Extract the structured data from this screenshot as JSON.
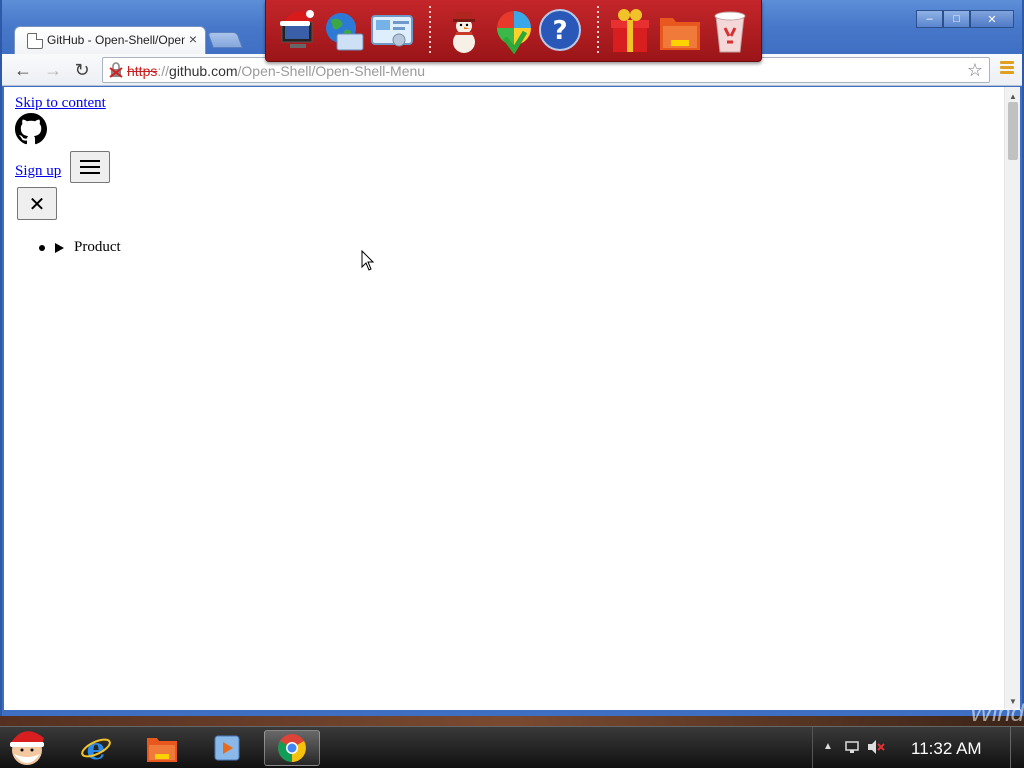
{
  "browser": {
    "tab": {
      "title": "GitHub - Open-Shell/Open-Shell-Menu",
      "close_glyph": "×"
    },
    "window_controls": {
      "minimize": "–",
      "maximize": "□",
      "close": "✕"
    },
    "toolbar": {
      "back_glyph": "←",
      "forward_glyph": "→",
      "reload_glyph": "↻",
      "url_scheme": "https",
      "url_separator": "://",
      "url_host": "github.com",
      "url_path": "/Open-Shell/Open-Shell-Menu",
      "star_glyph": "☆"
    }
  },
  "page": {
    "skip_link": "Skip to content",
    "signup_link": "Sign up",
    "close_glyph": "✕",
    "nav_items": [
      "Product"
    ]
  },
  "scrollbar": {
    "up_glyph": "▲",
    "down_glyph": "▼"
  },
  "desktop": {
    "watermark": "Wind"
  },
  "taskbar": {
    "tray_arrow": "▲",
    "clock": "11:32 AM"
  },
  "colors": {
    "title_bar": "#4677c9",
    "santa_bar": "#c4262a",
    "link": "#0000ee",
    "url_error": "#c92020"
  },
  "icons": {
    "santa_bar": [
      "computer-santa-hat-icon",
      "globe-icon",
      "control-panel-icon",
      "snowman-icon",
      "color-wheel-icon",
      "help-icon",
      "gift-icon",
      "folder-icon",
      "recycle-bin-icon"
    ],
    "taskbar": [
      "start-santa-icon",
      "internet-explorer-icon",
      "file-explorer-icon",
      "media-player-icon",
      "chrome-icon"
    ]
  }
}
